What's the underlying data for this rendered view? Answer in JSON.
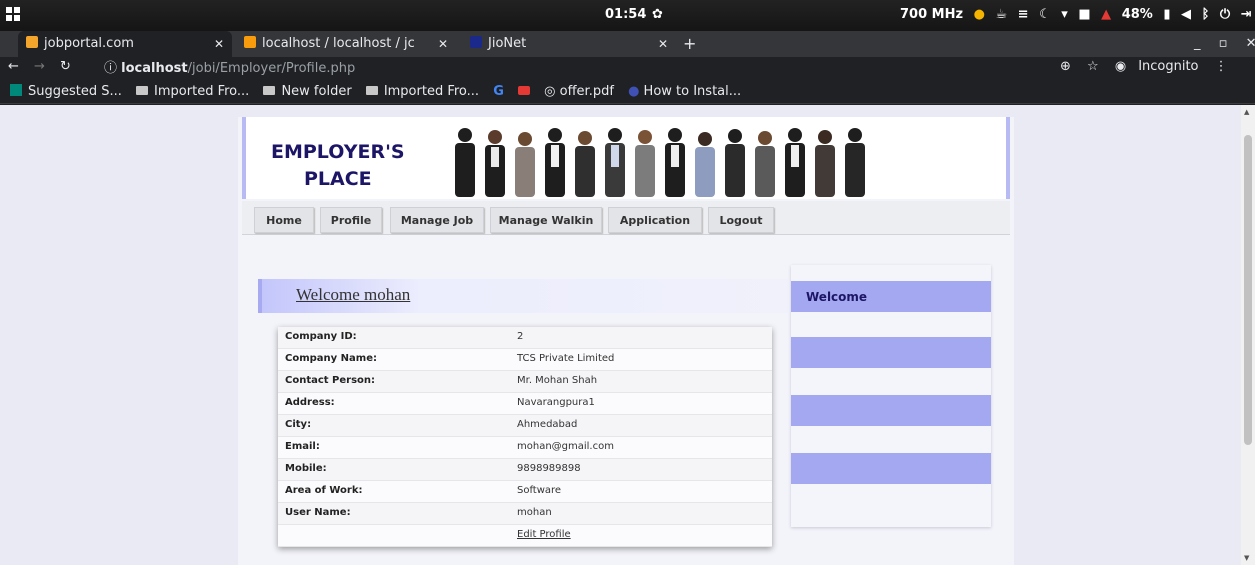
{
  "os": {
    "clock": "01:54",
    "cpu": "700 MHz",
    "battery": "48%"
  },
  "browser": {
    "tabs": [
      {
        "title": "jobportal.com",
        "active": true,
        "favicon_color": "#f4a52c"
      },
      {
        "title": "localhost / localhost / jc",
        "active": false,
        "favicon_color": "#f89c0e"
      },
      {
        "title": "JioNet",
        "active": false,
        "favicon_color": "#1b2a8a"
      }
    ],
    "url_host": "localhost",
    "url_path": "/jobi/Employer/Profile.php",
    "mode": "Incognito",
    "bookmarks": [
      {
        "label": "Suggested S...",
        "kind": "bing"
      },
      {
        "label": "Imported Fro...",
        "kind": "folder"
      },
      {
        "label": "New folder",
        "kind": "folder"
      },
      {
        "label": "Imported Fro...",
        "kind": "folder"
      },
      {
        "label": "",
        "kind": "google"
      },
      {
        "label": "",
        "kind": "youtube"
      },
      {
        "label": "offer.pdf",
        "kind": "globe"
      },
      {
        "label": "How to Instal...",
        "kind": "site"
      }
    ]
  },
  "site": {
    "brand_line1": "EMPLOYER'S",
    "brand_line2": "PLACE",
    "nav": [
      "Home",
      "Profile",
      "Manage Job",
      "Manage Walkin",
      "Application",
      "Logout"
    ],
    "welcome": "Welcome mohan",
    "profile": [
      {
        "label": "Company ID:",
        "value": "2"
      },
      {
        "label": "Company Name:",
        "value": "TCS Private Limited"
      },
      {
        "label": "Contact Person:",
        "value": "Mr. Mohan Shah"
      },
      {
        "label": "Address:",
        "value": "Navarangpura1"
      },
      {
        "label": "City:",
        "value": "Ahmedabad"
      },
      {
        "label": "Email:",
        "value": "mohan@gmail.com"
      },
      {
        "label": "Mobile:",
        "value": "9898989898"
      },
      {
        "label": "Area of Work:",
        "value": "Software"
      },
      {
        "label": "User Name:",
        "value": "mohan"
      },
      {
        "label": "",
        "value": "Edit Profile"
      }
    ],
    "sidebar_title": "Welcome"
  },
  "colors": {
    "accent": "#a4a8f0",
    "brand_text": "#1d1667"
  }
}
